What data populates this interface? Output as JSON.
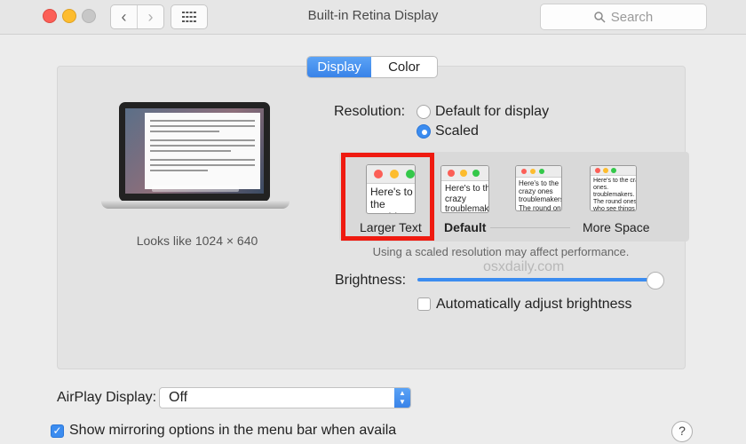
{
  "window": {
    "title": "Built-in Retina Display"
  },
  "search": {
    "label": "Search"
  },
  "tabs": [
    {
      "label": "Display"
    },
    {
      "label": "Color"
    }
  ],
  "preview": {
    "looks_like": "Looks like 1024 × 640"
  },
  "resolution": {
    "label": "Resolution:",
    "options": [
      {
        "label": "Default for display",
        "selected": false
      },
      {
        "label": "Scaled",
        "selected": true
      }
    ]
  },
  "scaling": {
    "options": [
      {
        "label": "Larger Text",
        "preview_text": "Here's to the troublem"
      },
      {
        "label": "Default",
        "preview_text": "Here's to the crazy troublemakers ones who see"
      },
      {
        "label": "",
        "preview_text": "Here's to the crazy ones troublemakers. The round ones who see things rules. And they have"
      },
      {
        "label": "More Space",
        "preview_text": "Here's to the crazy ones. troublemakers. The round ones who see things d rules. And they have no quote them, disagree"
      }
    ],
    "selected": "Larger Text",
    "note": "Using a scaled resolution may affect performance."
  },
  "watermark": "osxdaily.com",
  "brightness": {
    "label": "Brightness:",
    "level": 0.96
  },
  "auto_brightness": {
    "label": "Automatically adjust brightness",
    "checked": false
  },
  "airplay": {
    "label": "AirPlay Display:",
    "value": "Off"
  },
  "mirroring": {
    "label": "Show mirroring options in the menu bar when availa",
    "checked": true
  },
  "help": {
    "label": "?"
  },
  "colors": {
    "accent": "#3b8cf0",
    "highlight": "#ef1a10"
  }
}
